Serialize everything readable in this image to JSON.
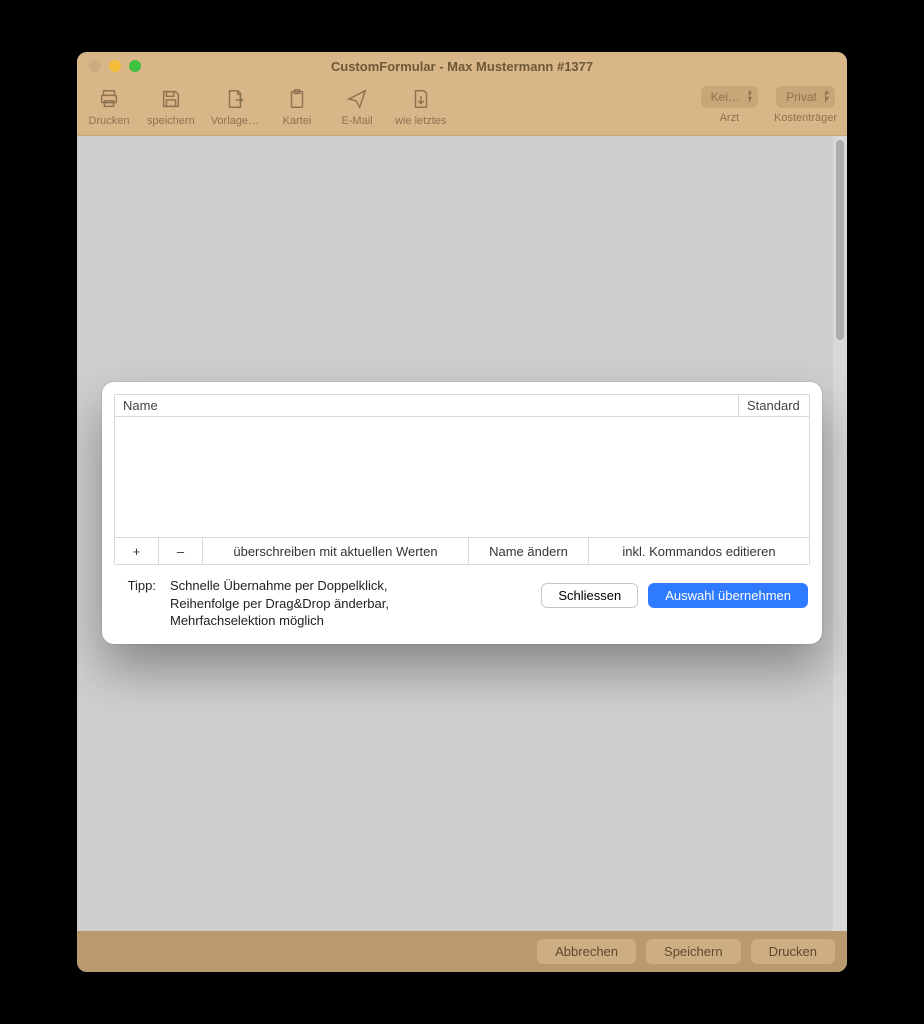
{
  "window": {
    "title": "CustomFormular -  Max Mustermann #1377"
  },
  "toolbar": {
    "items": [
      {
        "label": "Drucken"
      },
      {
        "label": "speichern"
      },
      {
        "label": "Vorlage…"
      },
      {
        "label": "Kartei"
      },
      {
        "label": "E-Mail"
      },
      {
        "label": "wie letztes"
      }
    ],
    "combo_arzt": {
      "value": "Kei…",
      "caption": "Arzt"
    },
    "combo_kost": {
      "value": "Privat",
      "caption": "Kostenträger"
    }
  },
  "sheet": {
    "columns": {
      "name": "Name",
      "standard": "Standard"
    },
    "actions": {
      "plus": "+",
      "minus": "–",
      "overwrite": "überschreiben mit aktuellen Werten",
      "rename": "Name ändern",
      "editcmds": "inkl. Kommandos editieren"
    },
    "tipp_label": "Tipp:",
    "tipp_text": "Schnelle Übernahme per Doppelklick, Reihenfolge per Drag&Drop änderbar, Mehrfachselektion möglich",
    "close": "Schliessen",
    "apply": "Auswahl übernehmen"
  },
  "footer": {
    "cancel": "Abbrechen",
    "save": "Speichern",
    "print": "Drucken"
  }
}
